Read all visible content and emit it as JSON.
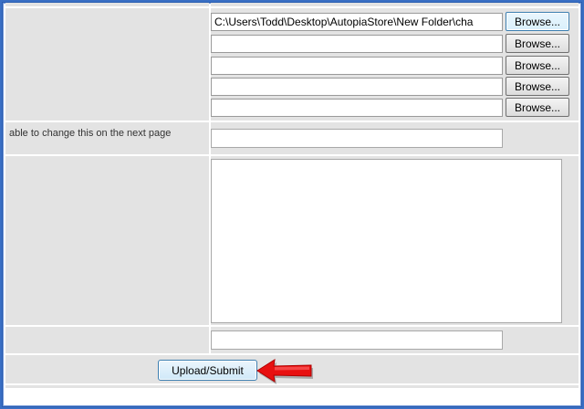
{
  "form": {
    "file_inputs": [
      {
        "value": "C:\\Users\\Todd\\Desktop\\AutopiaStore\\New Folder\\cha",
        "button_label": "Browse..."
      },
      {
        "value": "",
        "button_label": "Browse..."
      },
      {
        "value": "",
        "button_label": "Browse..."
      },
      {
        "value": "",
        "button_label": "Browse..."
      },
      {
        "value": "",
        "button_label": "Browse..."
      }
    ],
    "name_row_label": "able to change this on the next page",
    "name_value": "",
    "description_value": "",
    "extra_value": "",
    "submit_label": "Upload/Submit"
  },
  "annotation": {
    "arrow_color": "#e81010",
    "arrow_icon": "red-arrow-pointing-left"
  }
}
